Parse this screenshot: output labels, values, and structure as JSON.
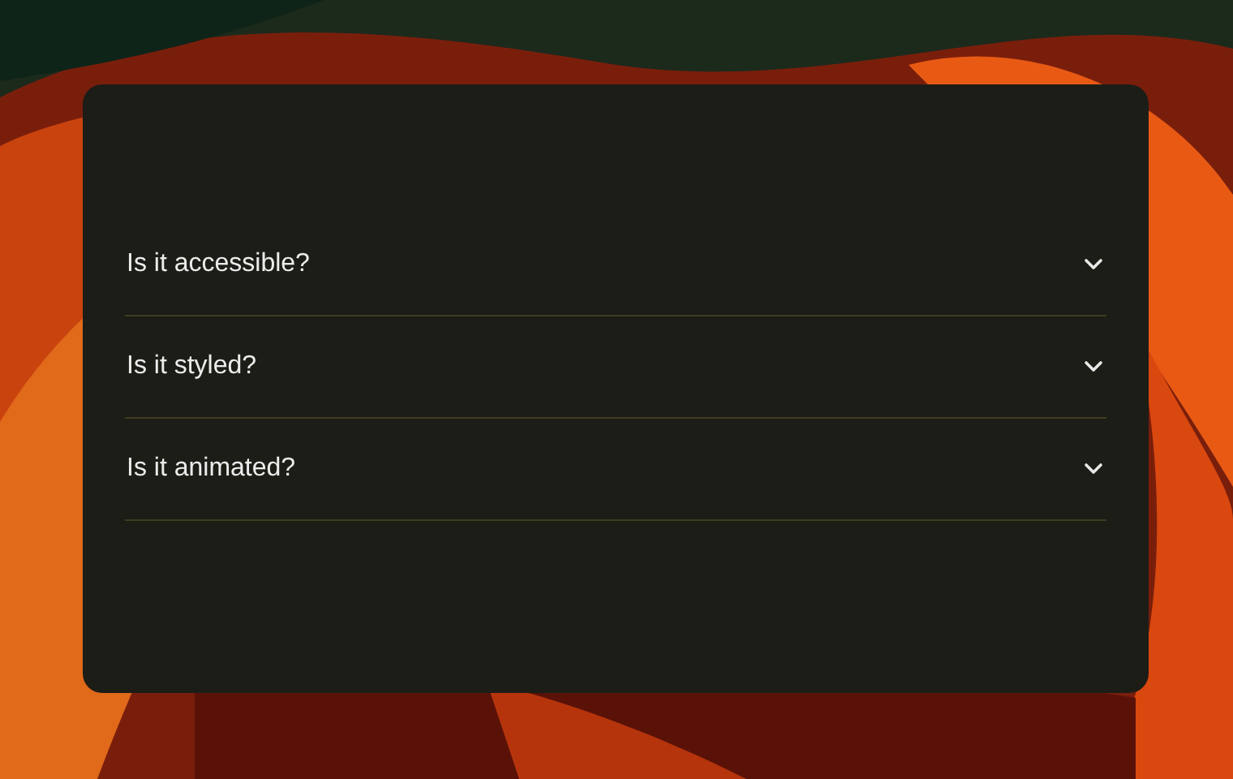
{
  "accordion": {
    "items": [
      {
        "question": "Is it accessible?",
        "expanded": false
      },
      {
        "question": "Is it styled?",
        "expanded": false
      },
      {
        "question": "Is it animated?",
        "expanded": false
      }
    ]
  }
}
